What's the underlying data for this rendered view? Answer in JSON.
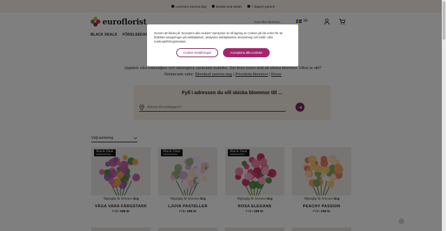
{
  "usp": [
    "Leverans samma dag",
    "Betala med Swish",
    "7 dagars garanti"
  ],
  "header": {
    "logo_text": "euroflorist",
    "search_hint": "Sök efter blomma...",
    "language": "SE"
  },
  "nav": [
    "BLACK DEALS",
    "FÖDELSEDAG"
  ],
  "intro": {
    "line1": "Upptäck våra bästsäljare och säsongens vackraste buketter. Det finns tusen skäl att skicka blommor. Vilket är ditt?",
    "related_label": "Relaterade sidor:",
    "related_links": [
      "Blombud samma dag",
      "Prisvärda blommor",
      "Rosor"
    ]
  },
  "address": {
    "title": "Fyll i adressen du vill skicka blommor till ...",
    "placeholder": "Adress till mottagaren*"
  },
  "sort": {
    "label": "Välj sortering"
  },
  "products": [
    {
      "name": "VÅGA VARA FÄRGSTARK",
      "price_prefix": "Från",
      "price": "289 kr",
      "badge": "Black Deal",
      "badge_sub": "LIMITED EDITION",
      "availability_prefix": "Tillgänglig för leverans",
      "availability_day": "idag",
      "colors": [
        "#c85aa8",
        "#8a5fb8",
        "#e06c9a",
        "#f0a44e",
        "#4f8a3c"
      ]
    },
    {
      "name": "LJUVA PASTELLER",
      "price_prefix": "Från",
      "price": "289 kr",
      "badge": "Black Deal",
      "badge_sub": "LIMITED EDITION",
      "availability_prefix": "Tillgänglig för leverans",
      "availability_day": "idag",
      "colors": [
        "#f2b8c8",
        "#c9a5d6",
        "#f6d9b5",
        "#e9e0ef",
        "#8fb07a"
      ]
    },
    {
      "name": "ROSA ELEGANS",
      "price_prefix": "Från",
      "price": "289 kr",
      "badge": "Black Deal",
      "badge_sub": "LIMITED EDITION",
      "availability_prefix": "Tillgänglig för leverans",
      "availability_day": "idag",
      "colors": [
        "#e0407a",
        "#f07aa3",
        "#c82a5f",
        "#f5a6c3",
        "#4e8a3d"
      ]
    },
    {
      "name": "PEACHY PASSION",
      "price_prefix": "Från",
      "price": "299 kr",
      "badge": "",
      "badge_sub": "",
      "availability_prefix": "Tillgänglig för leverans",
      "availability_day": "idag",
      "colors": [
        "#f5a06a",
        "#f0c86e",
        "#e8735a",
        "#f7d3a8",
        "#7fa562"
      ]
    }
  ],
  "cookie": {
    "text": "Genom att klicka på \"acceptera alla cookies\" samtycker du till lagring av cookies på din enhet för att förbättra navigeringen på webbplatsen, analysera webbplatsens användning och bistå i våra marknadsföringsinsatser.",
    "settings_label": "Cookie-inställningar",
    "accept_label": "Acceptera alla cookies"
  },
  "colors": {
    "brand": "#7a2b5c",
    "accept": "#a3266d",
    "sand": "#f6efe7"
  }
}
